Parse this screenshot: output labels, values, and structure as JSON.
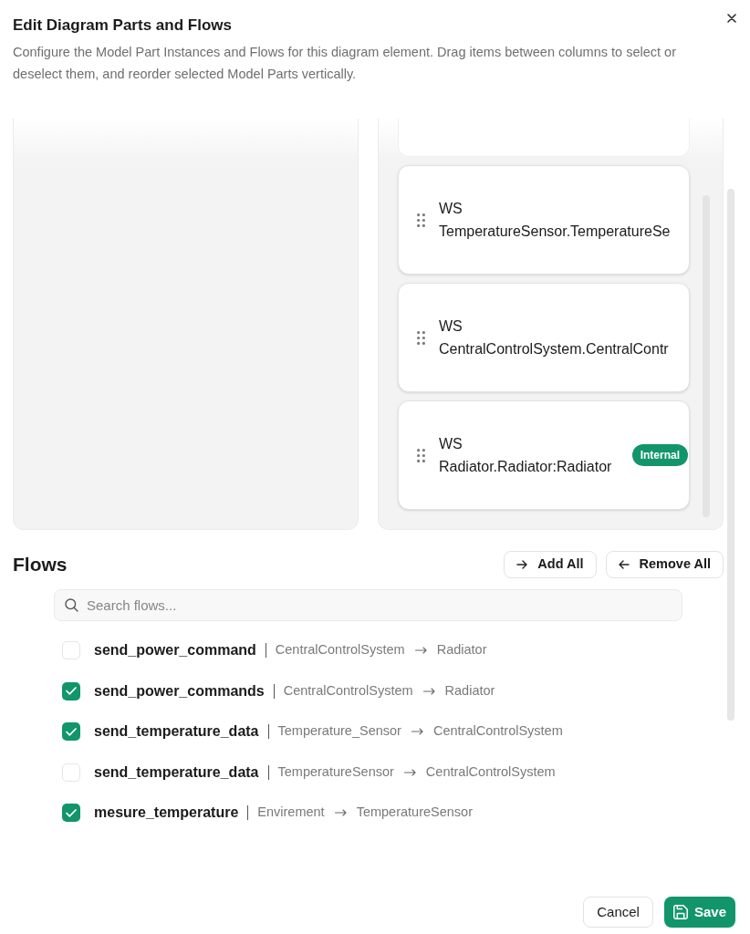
{
  "dialog": {
    "title": "Edit Diagram Parts and Flows",
    "description": "Configure the Model Part Instances and Flows for this diagram element. Drag items between columns to select or deselect them, and reorder selected Model Parts vertically."
  },
  "selected_parts": [
    {
      "prefix": "WS",
      "name": "TemperatureSensor.TemperatureSe"
    },
    {
      "prefix": "WS",
      "name": "CentralControlSystem.CentralContr"
    },
    {
      "prefix": "WS",
      "name": "Radiator.Radiator:Radiator",
      "badge": "Internal"
    }
  ],
  "flows": {
    "title": "Flows",
    "actions": [
      {
        "kind": "add",
        "label": "Add All"
      },
      {
        "kind": "remove",
        "label": "Remove All"
      }
    ],
    "search": {
      "placeholder": "Search flows..."
    },
    "items": [
      {
        "name": "send_power_command",
        "source": "CentralControlSystem",
        "target": "Radiator",
        "checked": false
      },
      {
        "name": "send_power_commands",
        "source": "CentralControlSystem",
        "target": "Radiator",
        "checked": true
      },
      {
        "name": "send_temperature_data",
        "source": "Temperature_Sensor",
        "target": "CentralControlSystem",
        "checked": true
      },
      {
        "name": "send_temperature_data",
        "source": "TemperatureSensor",
        "target": "CentralControlSystem",
        "checked": false
      },
      {
        "name": "mesure_temperature",
        "source": "Envirement",
        "target": "TemperatureSensor",
        "checked": true
      }
    ]
  },
  "footer": {
    "buttons": [
      {
        "kind": "secondary",
        "label": "Cancel"
      },
      {
        "kind": "primary",
        "label": "Save"
      }
    ]
  }
}
